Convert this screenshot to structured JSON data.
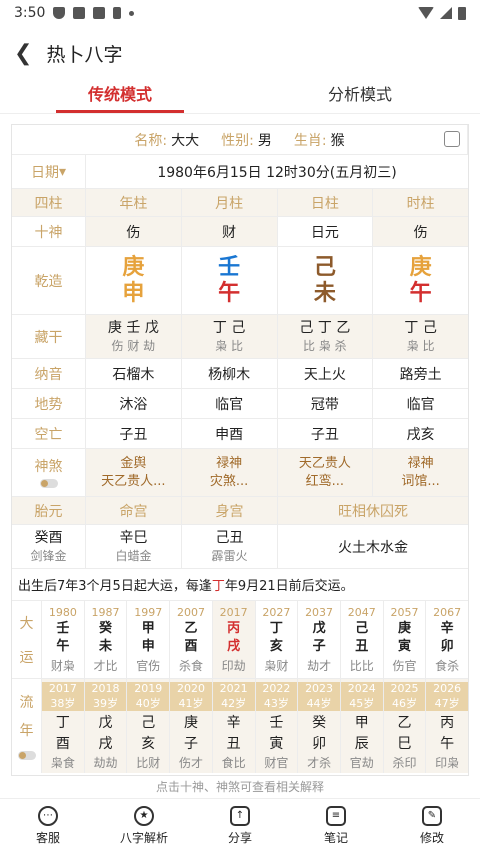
{
  "status": {
    "time": "3:50"
  },
  "header": {
    "title": "热卜八字"
  },
  "tabs": [
    {
      "label": "传统模式"
    },
    {
      "label": "分析模式"
    }
  ],
  "info": {
    "name_label": "名称:",
    "name": "大大",
    "gender_label": "性别:",
    "gender": "男",
    "zodiac_label": "生肖:",
    "zodiac": "猴"
  },
  "date_row": {
    "label": "日期",
    "value": "1980年6月15日 12时30分(五月初三)"
  },
  "pillars_header": {
    "label": "四柱",
    "cols": [
      "年柱",
      "月柱",
      "日柱",
      "时柱"
    ]
  },
  "shishen": {
    "label": "十神",
    "cols": [
      "伤",
      "财",
      "日元",
      "伤"
    ]
  },
  "qianzao": {
    "label": "乾造",
    "cols": [
      [
        "庚",
        "申"
      ],
      [
        "壬",
        "午"
      ],
      [
        "己",
        "未"
      ],
      [
        "庚",
        "午"
      ]
    ]
  },
  "canggan": {
    "label": "藏干",
    "cols": [
      [
        "庚 壬 戊",
        "伤 财 劫"
      ],
      [
        "丁 己",
        "枭 比"
      ],
      [
        "己 丁 乙",
        "比 枭 杀"
      ],
      [
        "丁 己",
        "枭 比"
      ]
    ]
  },
  "nayin": {
    "label": "纳音",
    "cols": [
      "石榴木",
      "杨柳木",
      "天上火",
      "路旁土"
    ]
  },
  "dishi": {
    "label": "地势",
    "cols": [
      "沐浴",
      "临官",
      "冠带",
      "临官"
    ]
  },
  "kongwang": {
    "label": "空亡",
    "cols": [
      "子丑",
      "申酉",
      "子丑",
      "戌亥"
    ]
  },
  "shensha": {
    "label": "神煞",
    "cols": [
      [
        "金舆",
        "天乙贵人..."
      ],
      [
        "禄神",
        "灾煞..."
      ],
      [
        "天乙贵人",
        "红鸾..."
      ],
      [
        "禄神",
        "词馆..."
      ]
    ]
  },
  "taiyuan": {
    "labels": [
      "胎元",
      "命宫",
      "身宫",
      "旺相休囚死"
    ],
    "values": [
      [
        "癸酉",
        "剑锋金"
      ],
      [
        "辛巳",
        "白蜡金"
      ],
      [
        "己丑",
        "霹雷火"
      ]
    ],
    "wx": "火土木水金"
  },
  "luck_note": {
    "pre": "出生后7年3个月5日起大运，每逢",
    "hl": "丁",
    "post": "年9月21日前后交运。"
  },
  "dayun": {
    "label": [
      "大",
      "运"
    ],
    "years": [
      "1980",
      "1987",
      "1997",
      "2007",
      "2017",
      "2027",
      "2037",
      "2047",
      "2057",
      "2067"
    ],
    "gz": [
      [
        "壬",
        "午"
      ],
      [
        "癸",
        "未"
      ],
      [
        "甲",
        "申"
      ],
      [
        "乙",
        "酉"
      ],
      [
        "丙",
        "戌"
      ],
      [
        "丁",
        "亥"
      ],
      [
        "戊",
        "子"
      ],
      [
        "己",
        "丑"
      ],
      [
        "庚",
        "寅"
      ],
      [
        "辛",
        "卯"
      ]
    ],
    "ss": [
      "财枭",
      "才比",
      "官伤",
      "杀食",
      "印劫",
      "枭财",
      "劫才",
      "比比",
      "伤官",
      "食杀"
    ]
  },
  "liunian": {
    "label": [
      "流",
      "年"
    ],
    "years": [
      "2017",
      "2018",
      "2019",
      "2020",
      "2021",
      "2022",
      "2023",
      "2024",
      "2025",
      "2026"
    ],
    "ages": [
      "38岁",
      "39岁",
      "40岁",
      "41岁",
      "42岁",
      "43岁",
      "44岁",
      "45岁",
      "46岁",
      "47岁"
    ],
    "gz": [
      [
        "丁",
        "酉"
      ],
      [
        "戊",
        "戌"
      ],
      [
        "己",
        "亥"
      ],
      [
        "庚",
        "子"
      ],
      [
        "辛",
        "丑"
      ],
      [
        "壬",
        "寅"
      ],
      [
        "癸",
        "卯"
      ],
      [
        "甲",
        "辰"
      ],
      [
        "乙",
        "巳"
      ],
      [
        "丙",
        "午"
      ]
    ],
    "ss": [
      "枭食",
      "劫劫",
      "比财",
      "伤才",
      "食比",
      "财官",
      "才杀",
      "官劫",
      "杀印",
      "印枭"
    ]
  },
  "hint": "点击十神、神煞可查看相关解释",
  "bottom": [
    {
      "label": "客服"
    },
    {
      "label": "八字解析"
    },
    {
      "label": "分享"
    },
    {
      "label": "笔记"
    },
    {
      "label": "修改"
    }
  ]
}
